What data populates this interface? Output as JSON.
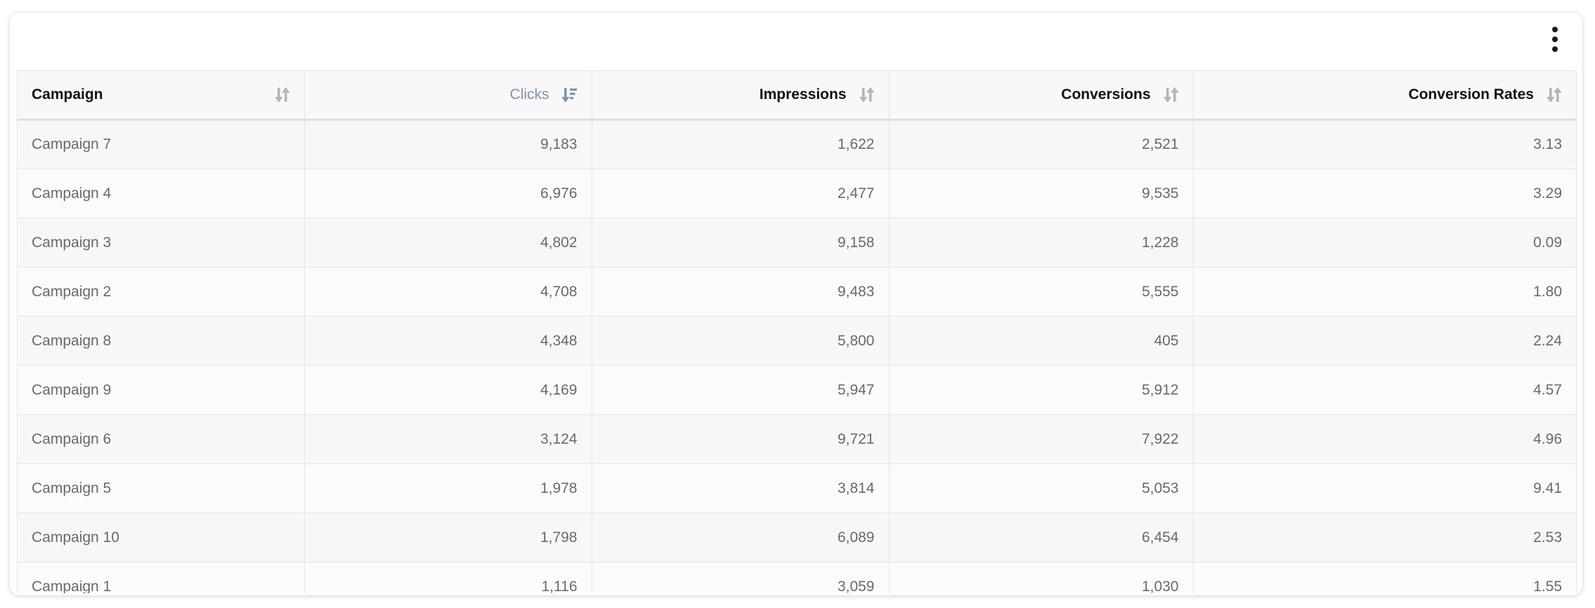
{
  "menu": {
    "icon": "more-vertical-icon"
  },
  "table": {
    "columns": [
      {
        "label": "Campaign",
        "sort_icon": "sort-icon",
        "active": false
      },
      {
        "label": "Clicks",
        "sort_icon": "sort-descending-icon",
        "active": true
      },
      {
        "label": "Impressions",
        "sort_icon": "sort-icon",
        "active": false
      },
      {
        "label": "Conversions",
        "sort_icon": "sort-icon",
        "active": false
      },
      {
        "label": "Conversion Rates",
        "sort_icon": "sort-icon",
        "active": false
      }
    ],
    "rows": [
      [
        "Campaign 7",
        "9,183",
        "1,622",
        "2,521",
        "3.13"
      ],
      [
        "Campaign 4",
        "6,976",
        "2,477",
        "9,535",
        "3.29"
      ],
      [
        "Campaign 3",
        "4,802",
        "9,158",
        "1,228",
        "0.09"
      ],
      [
        "Campaign 2",
        "4,708",
        "9,483",
        "5,555",
        "1.80"
      ],
      [
        "Campaign 8",
        "4,348",
        "5,800",
        "405",
        "2.24"
      ],
      [
        "Campaign 9",
        "4,169",
        "5,947",
        "5,912",
        "4.57"
      ],
      [
        "Campaign 6",
        "3,124",
        "9,721",
        "7,922",
        "4.96"
      ],
      [
        "Campaign 5",
        "1,978",
        "3,814",
        "5,053",
        "9.41"
      ],
      [
        "Campaign 10",
        "1,798",
        "6,089",
        "6,454",
        "2.53"
      ],
      [
        "Campaign 1",
        "1,116",
        "3,059",
        "1,030",
        "1.55"
      ]
    ]
  },
  "colors": {
    "header_text": "#111111",
    "active_header_text": "#7f94ad",
    "cell_text": "#666a6e",
    "sort_icon_inactive": "#b5b5b5",
    "sort_icon_active": "#7f94ad"
  }
}
